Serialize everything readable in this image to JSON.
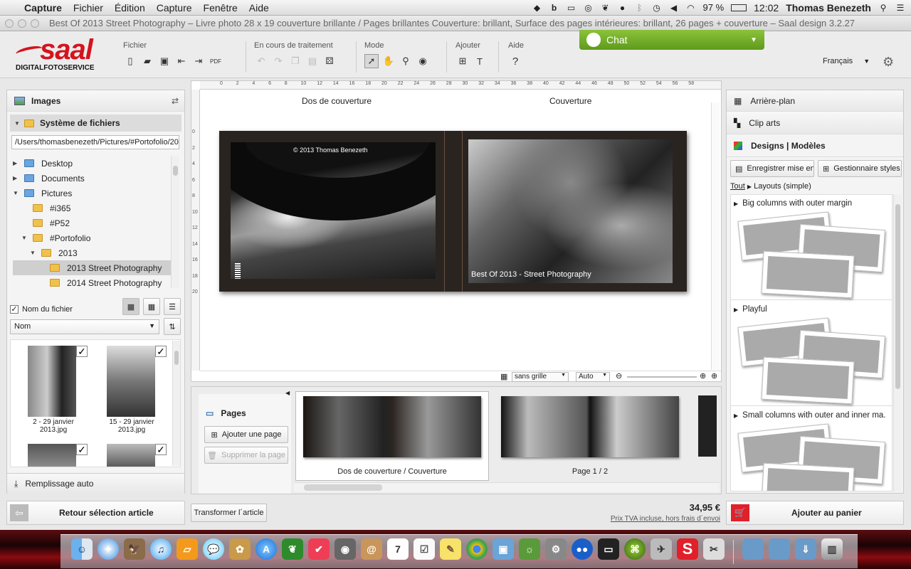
{
  "menubar": {
    "app": "Capture",
    "items": [
      "Fichier",
      "Édition",
      "Capture",
      "Fenêtre",
      "Aide"
    ],
    "battery": "97 %",
    "time": "12:02",
    "user": "Thomas Benezeth"
  },
  "window": {
    "title": "Best Of 2013 Street Photography – Livre photo 28 x 19 couverture brillante / Pages brillantes Couverture: brillant, Surface des pages intérieures: brillant, 26 pages + couverture – Saal design 3.2.27"
  },
  "toolbar": {
    "logo_main": "saal",
    "logo_sub": "DIGITALFOTOSERVICE",
    "group_fichier": "Fichier",
    "group_traitement": "En cours de traitement",
    "group_mode": "Mode",
    "group_ajouter": "Ajouter",
    "group_aide": "Aide",
    "aide_symbol": "?",
    "chat_label": "Chat",
    "language": "Français"
  },
  "left_panel": {
    "images_label": "Images",
    "filesystem_label": "Système de fichiers",
    "path": "/Users/thomasbenezeth/Pictures/#Portofolio/201",
    "tree": [
      {
        "label": "Desktop",
        "expanded": false,
        "indent": 0,
        "icon": "blue"
      },
      {
        "label": "Documents",
        "expanded": false,
        "indent": 0,
        "icon": "blue"
      },
      {
        "label": "Pictures",
        "expanded": true,
        "indent": 0,
        "icon": "blue"
      },
      {
        "label": "#i365",
        "expanded": null,
        "indent": 1,
        "icon": "yellow"
      },
      {
        "label": "#P52",
        "expanded": null,
        "indent": 1,
        "icon": "yellow"
      },
      {
        "label": "#Portofolio",
        "expanded": true,
        "indent": 1,
        "icon": "yellow"
      },
      {
        "label": "2013",
        "expanded": true,
        "indent": 2,
        "icon": "yellow"
      },
      {
        "label": "2013 Street Photography",
        "expanded": null,
        "indent": 3,
        "icon": "yellow",
        "selected": true
      },
      {
        "label": "2014 Street Photography",
        "expanded": null,
        "indent": 3,
        "icon": "yellow"
      }
    ],
    "filename_checkbox": "Nom du fichier",
    "sort_select": "Nom",
    "thumbs": [
      {
        "caption1": "2 - 29 janvier",
        "caption2": "2013.jpg"
      },
      {
        "caption1": "15 - 29 janvier",
        "caption2": "2013.jpg"
      }
    ],
    "autofill": "Remplissage auto"
  },
  "canvas": {
    "label_back": "Dos de couverture",
    "label_front": "Couverture",
    "ruler_top": [
      "0",
      "2",
      "4",
      "6",
      "8",
      "10",
      "12",
      "14",
      "16",
      "18",
      "20",
      "22",
      "24",
      "26",
      "28",
      "30",
      "32",
      "34",
      "36",
      "38",
      "40",
      "42",
      "44",
      "46",
      "48",
      "50",
      "52",
      "54",
      "56",
      "58"
    ],
    "ruler_left": [
      "0",
      "2",
      "4",
      "6",
      "8",
      "10",
      "12",
      "14",
      "16",
      "18",
      "20"
    ],
    "copyright_text": "© 2013 Thomas Benezeth",
    "cover_text": "Best Of 2013 - Street Photography",
    "grid_select": "sans grille",
    "zoom_select": "Auto"
  },
  "pages_panel": {
    "title": "Pages",
    "add_page": "Ajouter une page",
    "delete_page": "Supprimer la page",
    "thumb1_label": "Dos de couverture / Couverture",
    "thumb2_label": "Page 1 / 2"
  },
  "right_panel": {
    "background": "Arrière-plan",
    "clipart": "Clip arts",
    "designs": "Designs | Modèles",
    "save_layout": "Enregistrer mise en",
    "style_manager": "Gestionnaire styles",
    "breadcrumb_all": "Tout",
    "breadcrumb_sub": "Layouts (simple)",
    "sections": [
      "Big columns with outer margin",
      "Playful",
      "Small columns with outer and inner ma."
    ]
  },
  "footer": {
    "back_button": "Retour sélection article",
    "transform_button": "Transformer l´article",
    "price": "34,95 €",
    "price_note": "Prix TVA incluse, hors frais d´envoi",
    "cart_button": "Ajouter au panier"
  },
  "colors": {
    "accent_green": "#6aa82a",
    "logo_red": "#d4141c",
    "cart_red": "#e0202a"
  }
}
